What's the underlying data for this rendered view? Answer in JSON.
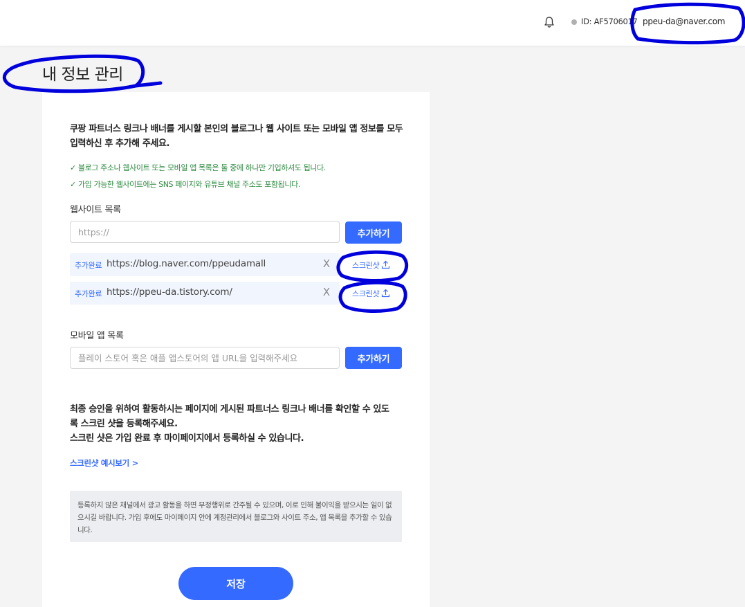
{
  "header": {
    "user_id": "ID: AF5706017",
    "email": "ppeu-da@naver.com"
  },
  "page": {
    "title": "내 정보 관리"
  },
  "intro": "쿠팡 파트너스 링크나 배너를 게시할 본인의 블로그나 웹 사이트 또는 모바일 앱 정보를 모두 입력하신 후 추가해 주세요.",
  "checks": [
    "✓ 블로그 주소나 웹사이트 또는 모바일 앱 목록은 둘 중에 하나만 기입하셔도 됩니다.",
    "✓ 가입 가능한 웹사이트에는 SNS 페이지와 유튜브 채널 주소도 포함됩니다."
  ],
  "websites": {
    "label": "웹사이트 목록",
    "placeholder": "https://",
    "add_label": "추가하기",
    "items": [
      {
        "status": "추가완료",
        "url": "https://blog.naver.com/ppeudamall",
        "remove": "X",
        "screenshot": "스크린샷"
      },
      {
        "status": "추가완료",
        "url": "https://ppeu-da.tistory.com/",
        "remove": "X",
        "screenshot": "스크린샷"
      }
    ]
  },
  "apps": {
    "label": "모바일 앱 목록",
    "placeholder": "플레이 스토어 혹은 애플 앱스토어의 앱 URL을 입력해주세요",
    "add_label": "추가하기"
  },
  "notice": {
    "line1": "최종 승인을 위하여 활동하시는 페이지에 게시된 파트너스 링크나 배너를 확인할 수 있도록 스크린 샷을 등록해주세요.",
    "line2": "스크린 샷은 가입 완료 후 마이페이지에서 등록하실 수 있습니다."
  },
  "example_link": "스크린샷 예시보기 >",
  "warning": "등록하지 않은 채널에서 광고 활동을 하면 부정행위로 간주될 수 있으며, 이로 인해 불이익을 받으시는 일이 없으시길 바랍니다. 가입 후에도 마이페이지 안에 계정관리에서 블로그와 사이트 주소, 앱 목록을 추가할 수 있습니다.",
  "save_label": "저장",
  "colors": {
    "accent": "#346aff",
    "check_green": "#2b8a3e",
    "annotation": "#0000dd"
  },
  "icons": [
    "bell-icon",
    "upload-icon",
    "close-icon"
  ]
}
